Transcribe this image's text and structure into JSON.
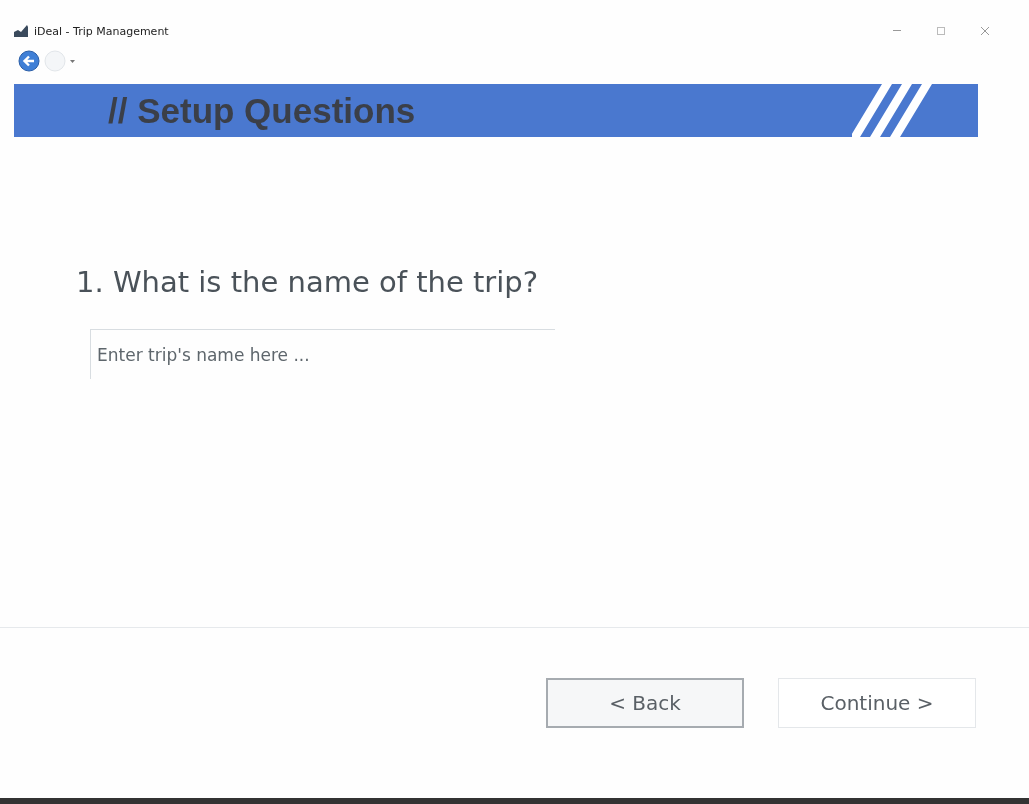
{
  "window": {
    "title": "iDeal - Trip Management"
  },
  "banner": {
    "title": "// Setup Questions"
  },
  "question": {
    "label": "1. What is the name of the trip?",
    "placeholder": "Enter trip's name here ..."
  },
  "buttons": [
    {
      "label": "< Back",
      "focused": true
    },
    {
      "label": "Continue >",
      "focused": false
    }
  ]
}
